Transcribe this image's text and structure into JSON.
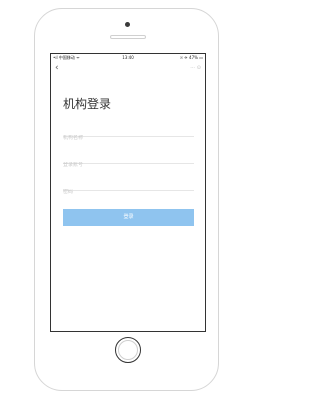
{
  "status_bar": {
    "carrier": "•ıl 中国移动 ᯤ",
    "time": "13:40",
    "right": "☉ ✈ 47% ▭"
  },
  "nav": {
    "back_icon": "chevron-left-icon",
    "right_icons": "⋯ ⊙"
  },
  "page": {
    "title": "机构登录"
  },
  "form": {
    "org_placeholder": "机构名称",
    "account_placeholder": "登录账号",
    "password_placeholder": "密码",
    "submit_label": "登录",
    "submit_color": "#8fc4ef"
  }
}
